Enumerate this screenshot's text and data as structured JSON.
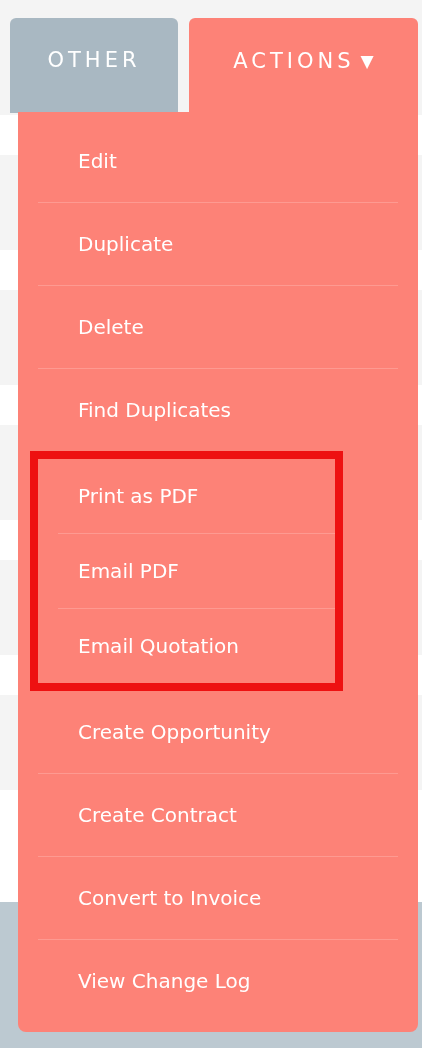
{
  "tabs": [
    {
      "label": "OTHER",
      "selected": false
    },
    {
      "label": "ACTIONS",
      "caret": "▼",
      "selected": true
    }
  ],
  "menu": {
    "items": [
      {
        "label": "Edit",
        "highlighted": false
      },
      {
        "label": "Duplicate",
        "highlighted": false
      },
      {
        "label": "Delete",
        "highlighted": false
      },
      {
        "label": "Find Duplicates",
        "highlighted": false
      },
      {
        "label": "Print as PDF",
        "highlighted": true
      },
      {
        "label": "Email PDF",
        "highlighted": true
      },
      {
        "label": "Email Quotation",
        "highlighted": true
      },
      {
        "label": "Create Opportunity",
        "highlighted": false
      },
      {
        "label": "Create Contract",
        "highlighted": false
      },
      {
        "label": "Convert to Invoice",
        "highlighted": false
      },
      {
        "label": "View Change Log",
        "highlighted": false
      }
    ]
  }
}
